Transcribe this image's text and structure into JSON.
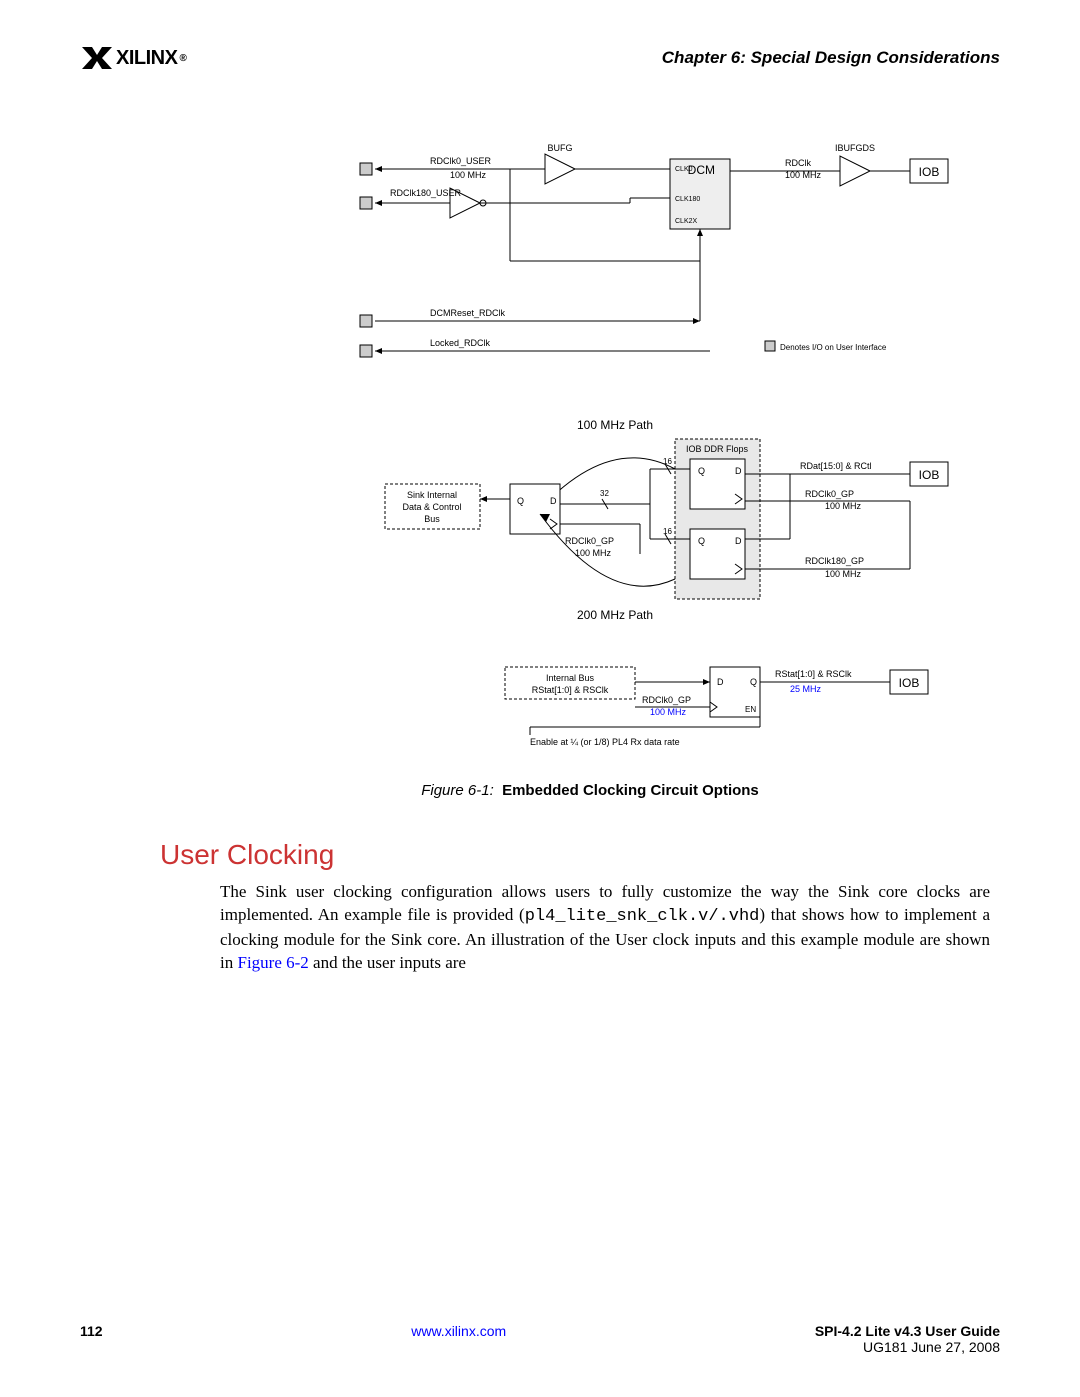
{
  "header": {
    "logo_text": "XILINX",
    "chapter_label": "Chapter 6:",
    "chapter_title": "Special Design Considerations"
  },
  "figure": {
    "label": "Figure 6-1:",
    "title": "Embedded Clocking Circuit Options",
    "diagram1": {
      "BUFG": "BUFG",
      "IBUFGDS": "IBUFGDS",
      "DCM": "DCM",
      "CLK0": "CLK0",
      "CLK180": "CLK180",
      "CLK2X": "CLK2X",
      "RDClk0_USER": "RDClk0_USER",
      "RDClk0_USER_freq": "100 MHz",
      "RDClk180_USER": "RDClk180_USER",
      "RDClk": "RDClk",
      "RDClk_freq": "100 MHz",
      "IOB": "IOB",
      "DCMReset_RDClk": "DCMReset_RDClk",
      "Locked_RDClk": "Locked_RDClk",
      "legend": "Denotes I/O on User Interface"
    },
    "diagram2": {
      "path100": "100 MHz Path",
      "path200": "200 MHz Path",
      "IOB_DDR": "IOB DDR Flops",
      "sink": "Sink Internal\nData & Control\nBus",
      "Q": "Q",
      "D": "D",
      "RDClk0_GP": "RDClk0_GP",
      "freq100": "100 MHz",
      "RDClk180_GP": "RDClk180_GP",
      "RDat": "RDat[15:0] & RCtl",
      "n16": "16",
      "n32": "32",
      "IOB": "IOB"
    },
    "diagram3": {
      "internal": "Internal Bus\nRStat[1:0] & RSClk",
      "D": "D",
      "Q": "Q",
      "EN": "EN",
      "RDClk0_GP": "RDClk0_GP",
      "freq100": "100 MHz",
      "RStat": "RStat[1:0] & RSClk",
      "freq25": "25 MHz",
      "IOB": "IOB",
      "enable": "Enable at ¼ (or 1/8) PL4 Rx data rate"
    }
  },
  "section_title": "User Clocking",
  "body": {
    "p1a": "The Sink user clocking configuration allows users to fully customize the way the Sink core clocks are implemented. An example file is provided (",
    "code": "pl4_lite_snk_clk.v/.vhd",
    "p1b": ") that shows how to implement a clocking module for the Sink core. An illustration of the User clock inputs and this example module are shown in ",
    "link": "Figure 6-2",
    "p1c": " and the user inputs are"
  },
  "footer": {
    "page": "112",
    "url": "www.xilinx.com",
    "guide": "SPI-4.2 Lite v4.3 User Guide",
    "guide_sub": "UG181 June 27, 2008"
  }
}
